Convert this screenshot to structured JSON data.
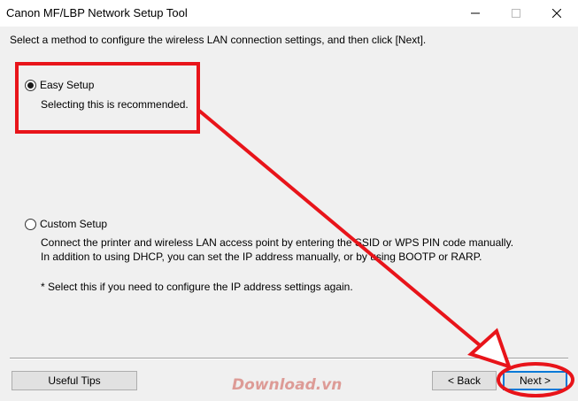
{
  "window": {
    "title": "Canon MF/LBP Network Setup Tool"
  },
  "instruction": "Select a method to configure the wireless LAN connection settings, and then click [Next].",
  "options": [
    {
      "label": "Easy Setup",
      "selected": true,
      "description": [
        "Selecting this is recommended."
      ]
    },
    {
      "label": "Custom Setup",
      "selected": false,
      "description": [
        "Connect the printer and wireless LAN access point by entering the SSID or WPS PIN code manually.",
        "In addition to using DHCP, you can set the IP address manually, or by using BOOTP or RARP."
      ],
      "note": "* Select this if you need to configure the IP address settings again."
    }
  ],
  "buttons": {
    "useful_tips": "Useful Tips",
    "back": "< Back",
    "next": "Next >"
  },
  "watermark": "Download.vn",
  "colors": {
    "annotation": "#e8141a",
    "focus": "#0078d7",
    "window_bg": "#f0f0f0"
  }
}
